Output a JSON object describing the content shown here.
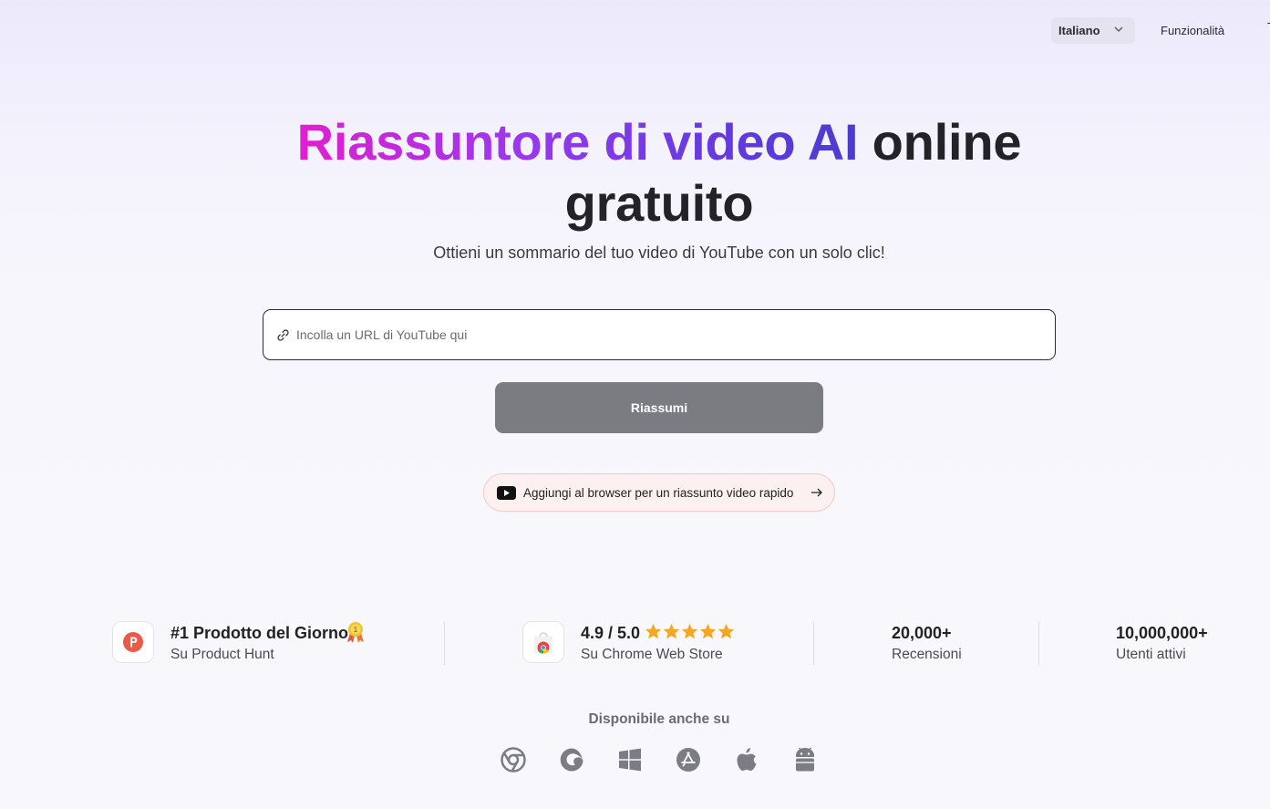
{
  "header": {
    "language_label": "Italiano",
    "nav_features": "Funzionalità",
    "nav_cut_char": "T"
  },
  "hero": {
    "title_gradient": "Riassuntore di video AI",
    "title_dark_1": "online",
    "title_dark_2": "gratuito",
    "subtitle": "Ottieni un sommario del tuo video di YouTube con un solo clic!",
    "url_placeholder": "Incolla un URL di YouTube qui",
    "url_value": "",
    "summarize_button": "Riassumi",
    "extension_cta": "Aggiungi al browser per un riassunto video rapido"
  },
  "stats": [
    {
      "main": "#1 Prodotto del Giorno",
      "sub": "Su Product Hunt",
      "icon": "product-hunt-icon"
    },
    {
      "main_rating": "4.9 / 5.0",
      "stars": 5,
      "sub": "Su Chrome Web Store",
      "icon": "chrome-web-store-icon"
    },
    {
      "main": "20,000+",
      "sub": "Recensioni"
    },
    {
      "main": "10,000,000+",
      "sub": "Utenti attivi"
    }
  ],
  "availability": {
    "label": "Disponibile anche su",
    "platforms": [
      "chrome-icon",
      "edge-icon",
      "windows-icon",
      "app-store-icon",
      "apple-icon",
      "android-icon"
    ]
  },
  "colors": {
    "title_gradient_start": "#e11fcf",
    "title_gradient_end": "#4b3bd0",
    "button_bg": "#7b7b82",
    "star": "#f5a623",
    "product_hunt": "#ea5a47"
  }
}
